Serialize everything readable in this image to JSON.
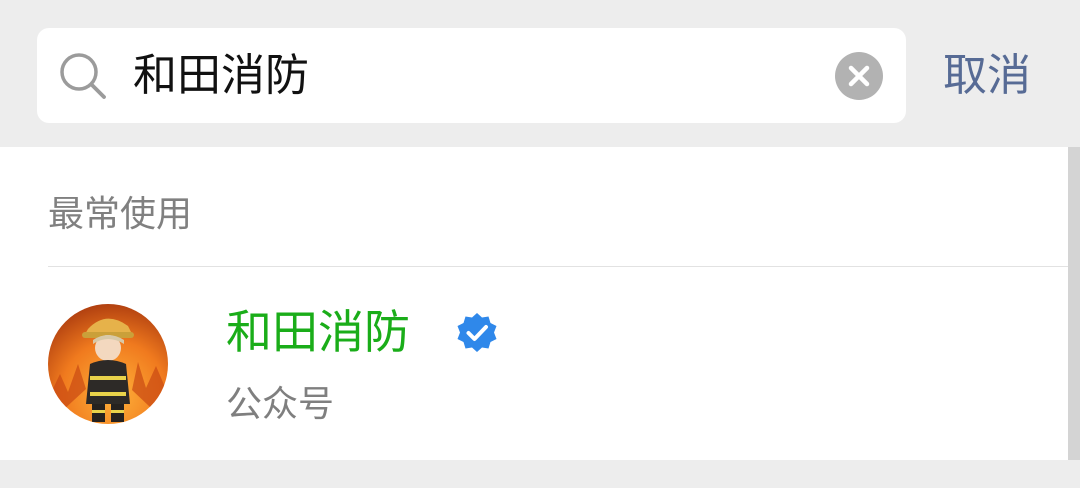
{
  "search": {
    "query": "和田消防",
    "cancel_label": "取消",
    "icon": "search-icon",
    "clear_icon": "clear-icon"
  },
  "section": {
    "title": "最常使用"
  },
  "results": [
    {
      "name": "和田消防",
      "type": "公众号",
      "verified": true,
      "avatar_icon": "firefighter-avatar",
      "name_color": "#1aad19",
      "verified_color": "#2f88ea"
    }
  ],
  "colors": {
    "link": "#576b95",
    "background": "#ededed",
    "secondary_text": "#808080"
  }
}
